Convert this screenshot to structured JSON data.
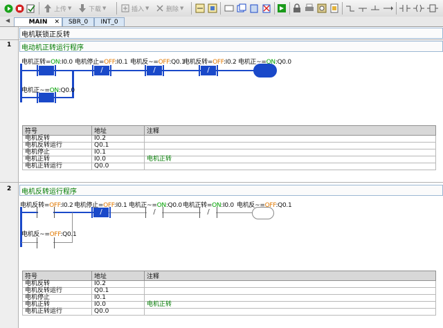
{
  "toolbar": {
    "items": [
      {
        "name": "run-icon",
        "color": "#1aa31a"
      },
      {
        "name": "stop-icon",
        "color": "#d22222"
      },
      {
        "name": "compile-icon",
        "color": "#555555"
      },
      {
        "name": "upload-icon",
        "label": "上传"
      },
      {
        "name": "download-icon",
        "label": "下载"
      },
      {
        "name": "insert-icon",
        "label": "插入"
      },
      {
        "name": "delete-icon",
        "label": "删除"
      }
    ]
  },
  "tabs": [
    {
      "label": "MAIN",
      "active": true
    },
    {
      "label": "SBR_0",
      "active": false
    },
    {
      "label": "INT_0",
      "active": false
    }
  ],
  "program_comment": "电机联锁正反转",
  "networks": [
    {
      "number": "1",
      "title": "电动机正转运行程序",
      "rung_main": [
        {
          "symbol": "电机正转",
          "state": "ON",
          "addr": "I0.0"
        },
        {
          "symbol": "电机停止",
          "state": "OFF",
          "addr": "I0.1"
        },
        {
          "symbol": "电机反~",
          "state": "OFF",
          "addr": "Q0.1"
        },
        {
          "symbol": "电机反转",
          "state": "OFF",
          "addr": "I0.2"
        },
        {
          "symbol": "电机正~",
          "state": "ON",
          "addr": "Q0.0"
        }
      ],
      "rung_branch": {
        "symbol": "电机正~",
        "state": "ON",
        "addr": "Q0.0"
      },
      "table": {
        "headers": [
          "符号",
          "地址",
          "注释"
        ],
        "rows": [
          [
            "电机反转",
            "I0.2",
            ""
          ],
          [
            "电机反转运行",
            "Q0.1",
            ""
          ],
          [
            "电机停止",
            "I0.1",
            ""
          ],
          [
            "电机正转",
            "I0.0",
            "电机正转"
          ],
          [
            "电机正转运行",
            "Q0.0",
            ""
          ]
        ]
      }
    },
    {
      "number": "2",
      "title": "电机反转运行程序",
      "rung_main": [
        {
          "symbol": "电机反转",
          "state": "OFF",
          "addr": "I0.2"
        },
        {
          "symbol": "电机停止",
          "state": "OFF",
          "addr": "I0.1"
        },
        {
          "symbol": "电机正~",
          "state": "ON",
          "addr": "Q0.0"
        },
        {
          "symbol": "电机正转",
          "state": "ON",
          "addr": "I0.0"
        },
        {
          "symbol": "电机反~",
          "state": "OFF",
          "addr": "Q0.1"
        }
      ],
      "rung_branch": {
        "symbol": "电机反~",
        "state": "OFF",
        "addr": "Q0.1"
      },
      "table": {
        "headers": [
          "符号",
          "地址",
          "注释"
        ],
        "rows": [
          [
            "电机反转",
            "I0.2",
            ""
          ],
          [
            "电机反转运行",
            "Q0.1",
            ""
          ],
          [
            "电机停止",
            "I0.1",
            ""
          ],
          [
            "电机正转",
            "I0.0",
            "电机正转"
          ],
          [
            "电机正转运行",
            "Q0.0",
            ""
          ]
        ]
      }
    }
  ]
}
